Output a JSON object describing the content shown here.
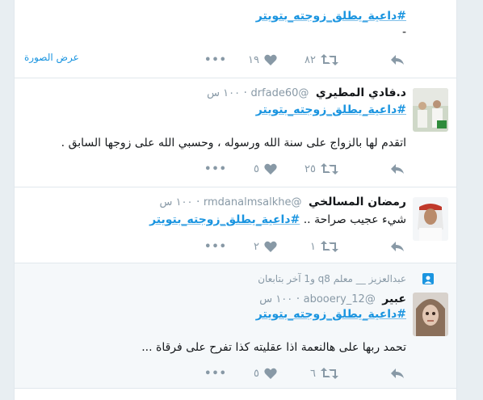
{
  "tweets": [
    {
      "hashtag": "#داعية_يطلق_زوجته_بتويتر",
      "text": "-",
      "retweets": "٨٢",
      "likes": "١٩",
      "view_image": "عرض الصورة"
    },
    {
      "name": "د.فادي المطيري",
      "handle": "@drfade60",
      "time": "١٠٠ س",
      "hashtag": "#داعية_يطلق_زوجته_بتويتر",
      "text": "اتقدم لها بالزواج على سنة الله ورسوله ، وحسبي الله على زوجها السابق .",
      "retweets": "٢٥",
      "likes": "٥"
    },
    {
      "name": "رمضان المسالخي",
      "handle": "@rmdanalmsalkhe",
      "time": "١٠٠ س",
      "text": "شيء عجيب صراحة ..",
      "hashtag": "#داعية_يطلق_زوجته_بتويتر",
      "retweets": "١",
      "likes": "٢"
    },
    {
      "retweeted_by": "عبدالعزيز __ معلم q8 و1 آخر بتابعان",
      "name": "عبير",
      "handle": "@abooery_12",
      "time": "١٠٠ س",
      "hashtag": "#داعية_يطلق_زوجته_بتويتر",
      "text": "تحمد ربها على هالنعمة اذا عقليته كذا تفرح على فرقاة ...",
      "retweets": "٦",
      "likes": "٥"
    }
  ],
  "icons": {
    "reply": "reply-icon",
    "retweet": "retweet-icon",
    "like": "heart-icon",
    "more": "more-icon",
    "social": "follow-context-icon"
  },
  "colors": {
    "link": "#1b95e0",
    "muted": "#8899a6",
    "text": "#14171a",
    "border": "#e1e8ed"
  }
}
